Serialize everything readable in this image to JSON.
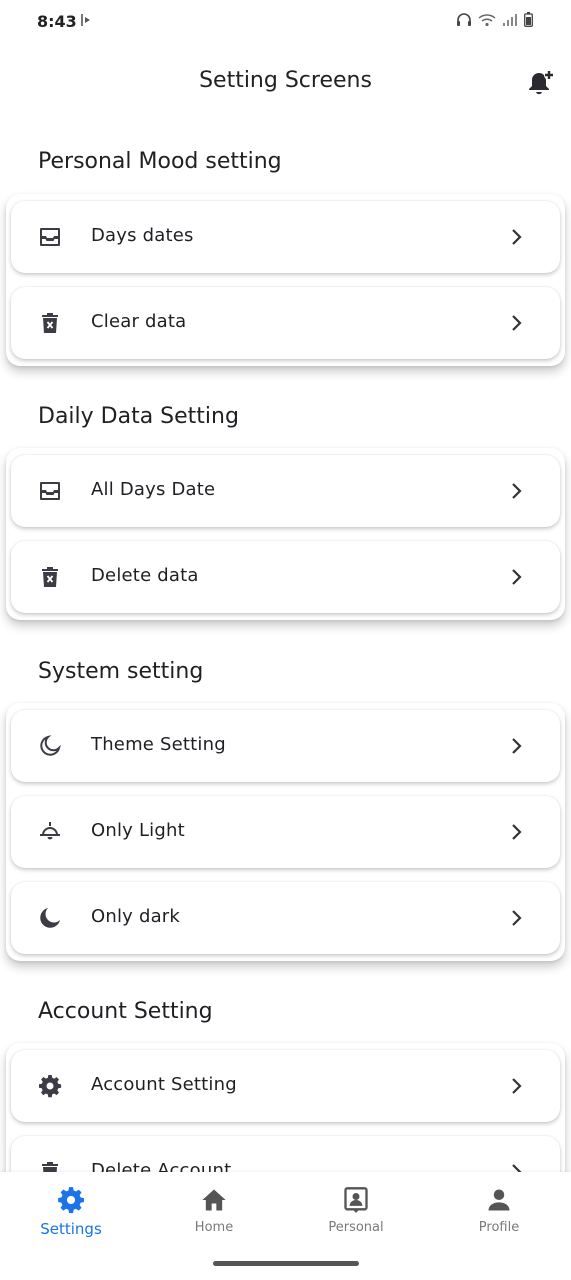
{
  "status_bar": {
    "time": "8:43"
  },
  "header": {
    "title": "Setting Screens"
  },
  "sections": [
    {
      "title": "Personal Mood setting",
      "items": [
        {
          "label": "Days dates",
          "icon": "inbox-tray-icon"
        },
        {
          "label": "Clear data",
          "icon": "trash-x-icon"
        }
      ]
    },
    {
      "title": "Daily Data Setting",
      "items": [
        {
          "label": "All Days Date",
          "icon": "inbox-tray-icon"
        },
        {
          "label": "Delete data",
          "icon": "trash-x-icon"
        }
      ]
    },
    {
      "title": "System setting",
      "items": [
        {
          "label": "Theme Setting",
          "icon": "moon-outline-icon"
        },
        {
          "label": "Only Light",
          "icon": "ceiling-lamp-icon"
        },
        {
          "label": "Only dark",
          "icon": "moon-filled-icon"
        }
      ]
    },
    {
      "title": "Account Setting",
      "items": [
        {
          "label": "Account Setting",
          "icon": "gear-icon"
        },
        {
          "label": "Delete Account",
          "icon": "trash-icon"
        }
      ]
    }
  ],
  "bottom_nav": [
    {
      "label": "Settings",
      "icon": "gear-icon",
      "active": true
    },
    {
      "label": "Home",
      "icon": "home-icon",
      "active": false
    },
    {
      "label": "Personal",
      "icon": "contact-card-icon",
      "active": false
    },
    {
      "label": "Profile",
      "icon": "person-icon",
      "active": false
    }
  ],
  "colors": {
    "accent": "#1a73e8",
    "icon": "#3c3c44",
    "text": "#1f1f24"
  }
}
